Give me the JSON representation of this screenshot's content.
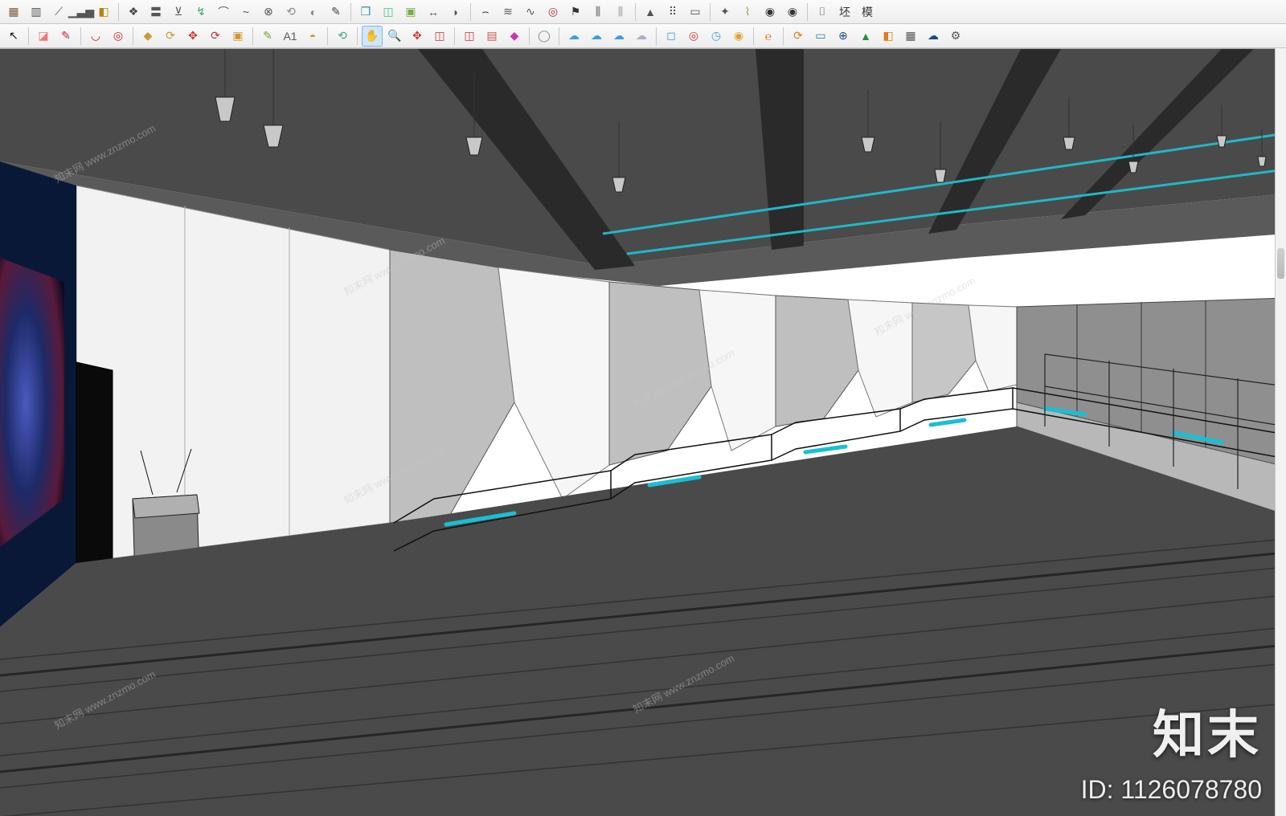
{
  "toolbar_row1": [
    {
      "name": "grid-icon",
      "glyph": "▦",
      "color": "#7a5c3a"
    },
    {
      "name": "column-icon",
      "glyph": "▥",
      "color": "#555"
    },
    {
      "name": "slope-icon",
      "glyph": "⟋",
      "color": "#555"
    },
    {
      "name": "bars-icon",
      "glyph": "▁▃▅",
      "color": "#555"
    },
    {
      "name": "sandbox-icon",
      "glyph": "◧",
      "color": "#b8860b"
    },
    {
      "name": "layer-icon",
      "glyph": "❖",
      "color": "#444"
    },
    {
      "name": "double-line-icon",
      "glyph": "〓",
      "color": "#555"
    },
    {
      "name": "stamp-icon",
      "glyph": "⊻",
      "color": "#555"
    },
    {
      "name": "follow-icon",
      "glyph": "↯",
      "color": "#3a6"
    },
    {
      "name": "arc-icon",
      "glyph": "⌒",
      "color": "#555"
    },
    {
      "name": "bezier-icon",
      "glyph": "~",
      "color": "#555"
    },
    {
      "name": "circle-x-icon",
      "glyph": "⊗",
      "color": "#555"
    },
    {
      "name": "rotate-3d-icon",
      "glyph": "⟲",
      "color": "#888"
    },
    {
      "name": "rotate-obj-icon",
      "glyph": "◐",
      "color": "#888"
    },
    {
      "name": "brush-icon",
      "glyph": "✎",
      "color": "#444"
    },
    {
      "name": "layers-stack-icon",
      "glyph": "❒",
      "color": "#38a"
    },
    {
      "name": "box-stack-icon",
      "glyph": "◫",
      "color": "#3c8"
    },
    {
      "name": "cube-icon",
      "glyph": "▣",
      "color": "#7a4"
    },
    {
      "name": "dim-icon",
      "glyph": "↔",
      "color": "#555"
    },
    {
      "name": "anim-icon",
      "glyph": "◗",
      "color": "#555"
    },
    {
      "name": "arch-icon",
      "glyph": "⌢",
      "color": "#333"
    },
    {
      "name": "road-icon",
      "glyph": "≋",
      "color": "#555"
    },
    {
      "name": "path-icon",
      "glyph": "∿",
      "color": "#555"
    },
    {
      "name": "spiral-icon",
      "glyph": "◎",
      "color": "#a33"
    },
    {
      "name": "flag-icon",
      "glyph": "⚑",
      "color": "#333"
    },
    {
      "name": "fence-icon",
      "glyph": "⫼",
      "color": "#555"
    },
    {
      "name": "fence-alt-icon",
      "glyph": "⫼",
      "color": "#999"
    },
    {
      "name": "flip-h-icon",
      "glyph": "▲",
      "color": "#555"
    },
    {
      "name": "grid-dots-icon",
      "glyph": "⠿",
      "color": "#555"
    },
    {
      "name": "page-icon",
      "glyph": "▭",
      "color": "#555"
    },
    {
      "name": "compass-icon",
      "glyph": "✦",
      "color": "#555"
    },
    {
      "name": "clean-icon",
      "glyph": "⌇",
      "color": "#8a5"
    },
    {
      "name": "coin-icon",
      "glyph": "◉",
      "color": "#333"
    },
    {
      "name": "coin2-icon",
      "glyph": "◉",
      "color": "#333"
    },
    {
      "name": "tag-1-icon",
      "glyph": "⌷",
      "color": "#555"
    },
    {
      "name": "tag-2-icon",
      "glyph": "坯",
      "color": "#333"
    },
    {
      "name": "tag-3-icon",
      "glyph": "模",
      "color": "#333"
    }
  ],
  "toolbar_row2": [
    {
      "name": "select-tool-icon",
      "glyph": "↖",
      "color": "#111"
    },
    {
      "name": "eraser-tool-icon",
      "glyph": "◪",
      "color": "#e77"
    },
    {
      "name": "pencil-tool-icon",
      "glyph": "✎",
      "color": "#c22"
    },
    {
      "name": "arc-tool-icon",
      "glyph": "◡",
      "color": "#c22"
    },
    {
      "name": "shape-tool-icon",
      "glyph": "◎",
      "color": "#c22"
    },
    {
      "name": "pushpull-tool-icon",
      "glyph": "◆",
      "color": "#c93"
    },
    {
      "name": "offset-tool-icon",
      "glyph": "⟳",
      "color": "#c93"
    },
    {
      "name": "move-tool-icon",
      "glyph": "✥",
      "color": "#c33"
    },
    {
      "name": "rotate-tool-icon",
      "glyph": "⟳",
      "color": "#c33"
    },
    {
      "name": "scale-tool-icon",
      "glyph": "▣",
      "color": "#c93"
    },
    {
      "name": "tape-tool-icon",
      "glyph": "✎",
      "color": "#6a3"
    },
    {
      "name": "text-tool-icon",
      "glyph": "A1",
      "color": "#555"
    },
    {
      "name": "paint-tool-icon",
      "glyph": "◓",
      "color": "#c93"
    },
    {
      "name": "orbit-tool-icon",
      "glyph": "⟲",
      "color": "#3a8"
    },
    {
      "name": "pan-tool-icon",
      "glyph": "✋",
      "color": "#ecb26e",
      "active": true
    },
    {
      "name": "zoom-tool-icon",
      "glyph": "🔍",
      "color": "#555"
    },
    {
      "name": "zoom-extents-tool-icon",
      "glyph": "✥",
      "color": "#c33"
    },
    {
      "name": "component-1-icon",
      "glyph": "◫",
      "color": "#c33"
    },
    {
      "name": "component-2-icon",
      "glyph": "◫",
      "color": "#c33"
    },
    {
      "name": "img-icon",
      "glyph": "▤",
      "color": "#c55"
    },
    {
      "name": "gem-icon",
      "glyph": "◆",
      "color": "#c3a"
    },
    {
      "name": "user-icon",
      "glyph": "◯",
      "color": "#888"
    },
    {
      "name": "cloud-1-icon",
      "glyph": "☁",
      "color": "#3aa0e0"
    },
    {
      "name": "cloud-2-icon",
      "glyph": "☁",
      "color": "#3aa0e0"
    },
    {
      "name": "cloud-3-icon",
      "glyph": "☁",
      "color": "#3aa0e0"
    },
    {
      "name": "cloud-4-icon",
      "glyph": "☁",
      "color": "#aac"
    },
    {
      "name": "select-box-icon",
      "glyph": "◻",
      "color": "#3aa0e0"
    },
    {
      "name": "target-icon",
      "glyph": "◎",
      "color": "#c33"
    },
    {
      "name": "timer-icon",
      "glyph": "◷",
      "color": "#3aa0e0"
    },
    {
      "name": "chrome-icon",
      "glyph": "◉",
      "color": "#e0a030"
    },
    {
      "name": "enscape-icon",
      "glyph": "℮",
      "color": "#e07a1a"
    },
    {
      "name": "sync-icon",
      "glyph": "⟳",
      "color": "#e07a1a"
    },
    {
      "name": "tv-icon",
      "glyph": "▭",
      "color": "#2a7cc0"
    },
    {
      "name": "add-circle-icon",
      "glyph": "⊕",
      "color": "#1a4a8a"
    },
    {
      "name": "tree-icon",
      "glyph": "▲",
      "color": "#2a8a3a"
    },
    {
      "name": "palette-icon",
      "glyph": "◧",
      "color": "#e07a1a"
    },
    {
      "name": "checker-icon",
      "glyph": "▦",
      "color": "#555"
    },
    {
      "name": "upload-cloud-icon",
      "glyph": "☁",
      "color": "#1a4a8a"
    },
    {
      "name": "settings-gear-icon",
      "glyph": "⚙",
      "color": "#555"
    }
  ],
  "scrollbar": {
    "thumb_top_pct": 26,
    "thumb_height_pct": 4
  },
  "watermark": {
    "brand": "知末",
    "id_label": "ID: 1126078780",
    "url": "www.znzmo.com",
    "url_cn": "知末网"
  }
}
